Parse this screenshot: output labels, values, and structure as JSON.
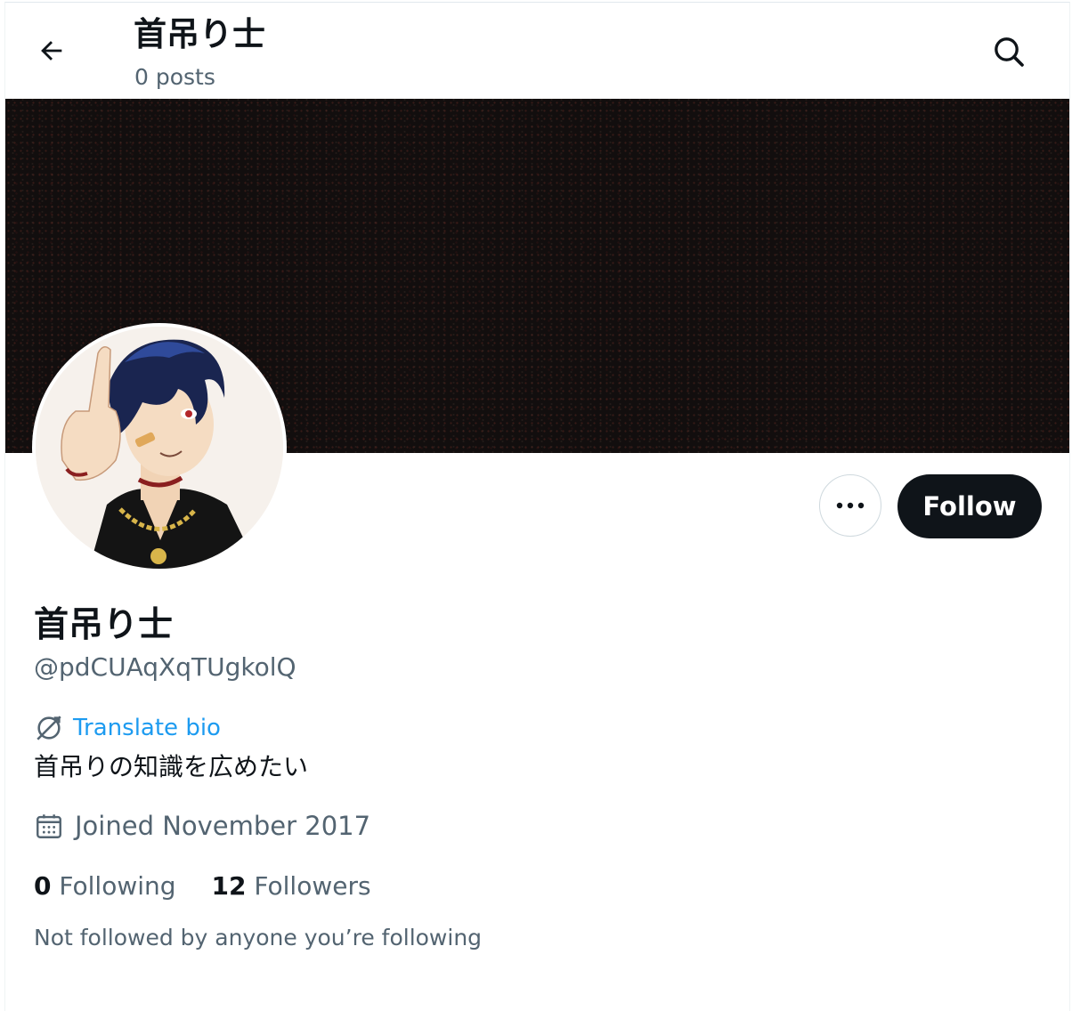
{
  "header": {
    "title": "首吊り士",
    "posts_count": "0 posts",
    "back_icon": "arrow-left-icon",
    "search_icon": "search-icon"
  },
  "profile": {
    "display_name": "首吊り士",
    "handle": "@pdCUAqXqTUgkolQ",
    "translate_label": "Translate bio",
    "bio": "首吊りの知識を広めたい",
    "joined": "Joined November 2017",
    "following_count": "0",
    "following_label": "Following",
    "followers_count": "12",
    "followers_label": "Followers",
    "not_followed_text": "Not followed by anyone you’re following"
  },
  "actions": {
    "more_icon": "more-horizontal-icon",
    "follow_label": "Follow"
  },
  "colors": {
    "text_primary": "#0f1419",
    "text_secondary": "#536471",
    "link_blue": "#1d9bf0",
    "follow_button_bg": "#0f1419",
    "banner_bg": "#120e0e"
  }
}
